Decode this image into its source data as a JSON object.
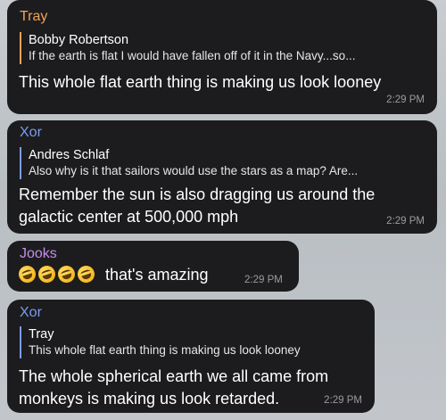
{
  "messages": [
    {
      "sender": "Tray",
      "sender_color": "#f0a35a",
      "reply_name": "Bobby Robertson",
      "reply_text": "If the earth is flat I would have fallen off of it in the Navy...so...",
      "text_lines": [
        "This whole flat earth thing is making us look looney"
      ],
      "time": "2:29 PM"
    },
    {
      "sender": "Xor",
      "sender_color": "#7c9bf0",
      "reply_name": "Andres Schlaf",
      "reply_text": "Also why is it that sailors would use the stars as a map? Are...",
      "text_lines": [
        "Remember the sun is also dragging us around the",
        "galactic center at 500,000 mph"
      ],
      "time": "2:29 PM"
    },
    {
      "sender": "Jooks",
      "sender_color": "#c58ee8",
      "emoji_icons": [
        "rofl-emoji-icon",
        "rofl-emoji-icon",
        "rofl-emoji-icon",
        "rofl-emoji-icon"
      ],
      "text": "that's amazing",
      "time": "2:29 PM"
    },
    {
      "sender": "Xor",
      "sender_color": "#7c9bf0",
      "reply_name": "Tray",
      "reply_text": "This whole flat earth thing is making us look looney",
      "text_lines": [
        "The whole spherical earth we all came from",
        "monkeys is making us look retarded."
      ],
      "time": "2:29 PM"
    }
  ]
}
